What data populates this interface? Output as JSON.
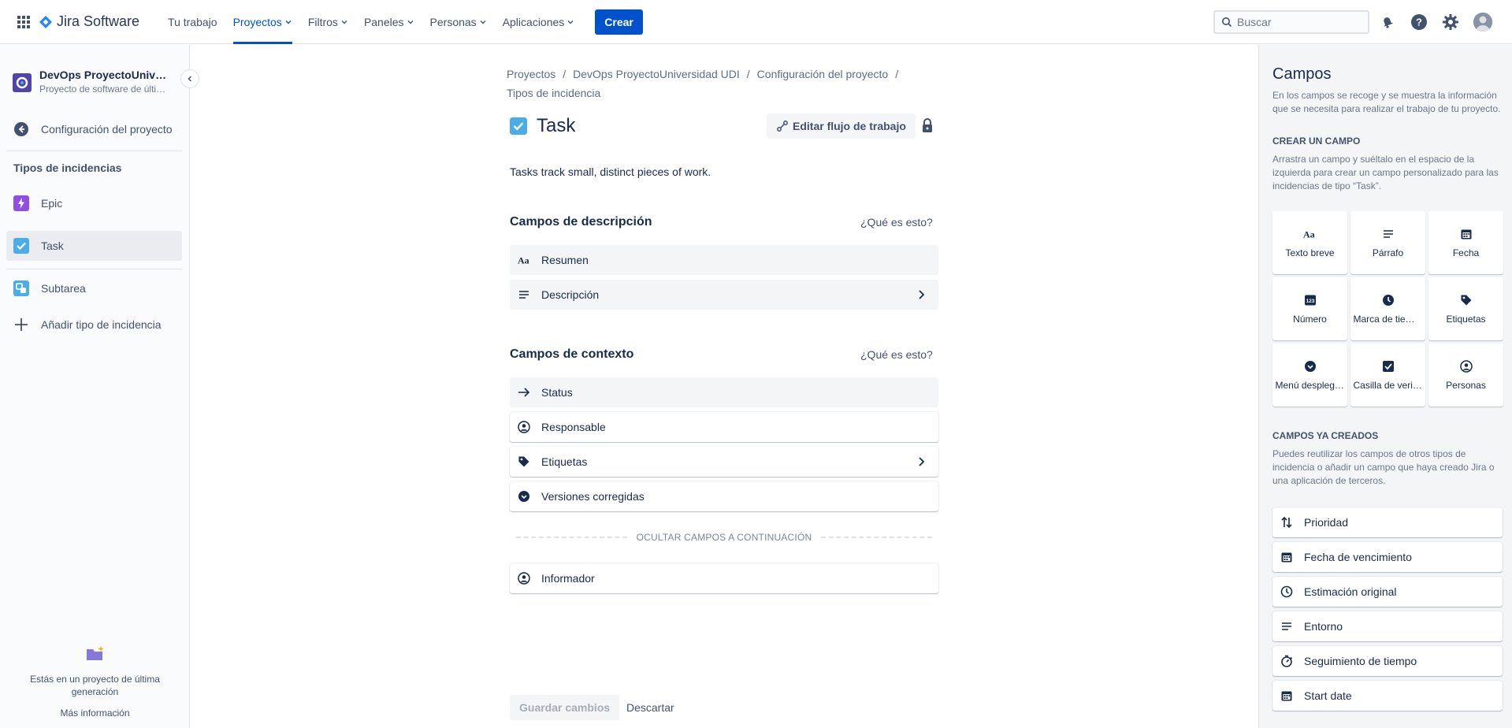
{
  "topnav": {
    "logo_text": "Jira Software",
    "items": [
      {
        "label": "Tu trabajo"
      },
      {
        "label": "Proyectos"
      },
      {
        "label": "Filtros"
      },
      {
        "label": "Paneles"
      },
      {
        "label": "Personas"
      },
      {
        "label": "Aplicaciones"
      }
    ],
    "create_label": "Crear",
    "search_placeholder": "Buscar",
    "active_color": "#0052cc"
  },
  "sidebar": {
    "project_name": "DevOps ProyectoUniversidad UDI",
    "project_sub": "Proyecto de software de última generación",
    "settings_label": "Configuración del proyecto",
    "section_heading": "Tipos de incidencias",
    "issue_types": [
      {
        "label": "Epic",
        "icon": "epic-icon",
        "color": "#904ee2"
      },
      {
        "label": "Task",
        "icon": "task-icon",
        "color": "#4bade8"
      },
      {
        "label": "Subtarea",
        "icon": "subtask-icon",
        "color": "#4bade8"
      }
    ],
    "add_label": "Añadir tipo de incidencia",
    "footer_text": "Estás en un proyecto de última generación",
    "footer_link": "Más información"
  },
  "main": {
    "breadcrumbs": [
      "Proyectos",
      "DevOps ProyectoUniversidad UDI",
      "Configuración del proyecto",
      "Tipos de incidencia"
    ],
    "issue_name": "Task",
    "edit_workflow_label": "Editar flujo de trabajo",
    "description": "Tasks track small, distinct pieces of work.",
    "desc_section": {
      "title": "Campos de descripción",
      "help": "¿Qué es esto?",
      "fields": [
        {
          "label": "Resumen",
          "icon": "text-aa-icon"
        },
        {
          "label": "Descripción",
          "icon": "paragraph-icon"
        }
      ]
    },
    "context_section": {
      "title": "Campos de contexto",
      "help": "¿Qué es esto?",
      "fields": [
        {
          "label": "Status",
          "icon": "arrow-right-icon"
        },
        {
          "label": "Responsable",
          "icon": "person-icon"
        },
        {
          "label": "Etiquetas",
          "icon": "tag-icon"
        },
        {
          "label": "Versiones corregidas",
          "icon": "dropdown-icon"
        }
      ]
    },
    "hidden_label": "OCULTAR CAMPOS A CONTINUACIÓN",
    "hidden_fields": [
      {
        "label": "Informador",
        "icon": "person-icon"
      }
    ],
    "save_label": "Guardar cambios",
    "discard_label": "Descartar"
  },
  "rpanel": {
    "title": "Campos",
    "desc": "En los campos se recoge y se muestra la información que se necesita para realizar el trabajo de tu proyecto.",
    "create_heading": "CREAR UN CAMPO",
    "create_desc": "Arrastra un campo y suéltalo en el espacio de la izquierda para crear un campo personalizado para las incidencias de tipo “Task”.",
    "field_types": [
      {
        "label": "Texto breve",
        "icon": "text-aa-icon"
      },
      {
        "label": "Párrafo",
        "icon": "paragraph-icon"
      },
      {
        "label": "Fecha",
        "icon": "calendar-icon"
      },
      {
        "label": "Número",
        "icon": "number-icon"
      },
      {
        "label": "Marca de tiempo",
        "icon": "clock-icon"
      },
      {
        "label": "Etiquetas",
        "icon": "tag-icon"
      },
      {
        "label": "Menú desplegable",
        "icon": "dropdown-icon"
      },
      {
        "label": "Casilla de verificación",
        "icon": "checkbox-icon"
      },
      {
        "label": "Personas",
        "icon": "person-icon"
      }
    ],
    "existing_heading": "CAMPOS YA CREADOS",
    "existing_desc": "Puedes reutilizar los campos de otros tipos de incidencia o añadir un campo que haya creado Jira o una aplicación de terceros.",
    "existing_fields": [
      {
        "label": "Prioridad",
        "icon": "priority-icon"
      },
      {
        "label": "Fecha de vencimiento",
        "icon": "calendar-icon"
      },
      {
        "label": "Estimación original",
        "icon": "clock-icon"
      },
      {
        "label": "Entorno",
        "icon": "paragraph-icon"
      },
      {
        "label": "Seguimiento de tiempo",
        "icon": "stopwatch-icon"
      },
      {
        "label": "Start date",
        "icon": "calendar-icon"
      }
    ]
  }
}
